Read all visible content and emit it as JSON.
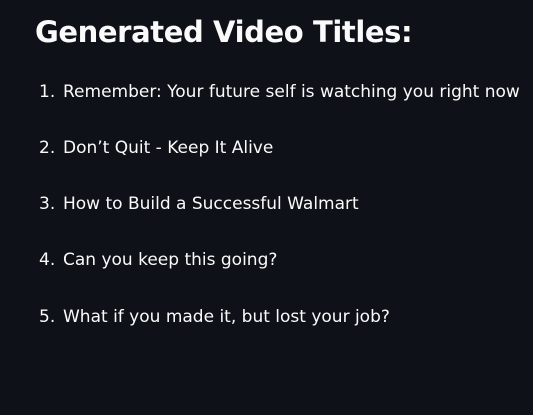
{
  "heading": "Generated Video Titles:",
  "titles": [
    {
      "number": "1.",
      "text": "Remember: Your future self is watching you right now"
    },
    {
      "number": "2.",
      "text": "Don’t Quit - Keep It Alive"
    },
    {
      "number": "3.",
      "text": "How to Build a Successful Walmart"
    },
    {
      "number": "4.",
      "text": "Can you keep this going?"
    },
    {
      "number": "5.",
      "text": "What if you made it, but lost your job?"
    }
  ]
}
